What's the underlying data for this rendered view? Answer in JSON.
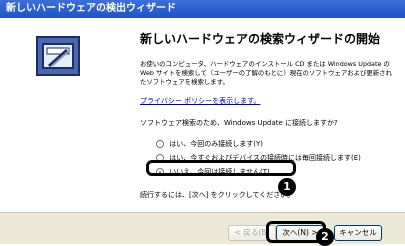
{
  "window": {
    "title": "新しいハードウェアの検出ウィザード"
  },
  "main": {
    "heading": "新しいハードウェアの検索ウィザードの開始",
    "description": "お使いのコンピュータ、ハードウェアのインストール CD または Windows Update の Web サイトを検索して（ユーザーの了解のもとに）現在のソフトウェアおよび更新されたソフトウェアを検索します。",
    "privacy_link": "プライバシー ポリシーを表示します。",
    "question": "ソフトウェア検索のため、Windows Update に接続しますか?",
    "options": [
      {
        "label": "はい、今回のみ接続します(Y)"
      },
      {
        "label": "はい、今すぐおよびデバイスの接続時には毎回接続します(E)"
      },
      {
        "label": "いいえ、今回は接続しません(T)"
      }
    ],
    "continue_text": "続行するには、[次へ] をクリックしてください。"
  },
  "buttons": {
    "back": "< 戻る(B)",
    "next": "次へ(N) >",
    "cancel": "キャンセル"
  },
  "annotations": {
    "callout_1": "1",
    "callout_2": "2"
  }
}
